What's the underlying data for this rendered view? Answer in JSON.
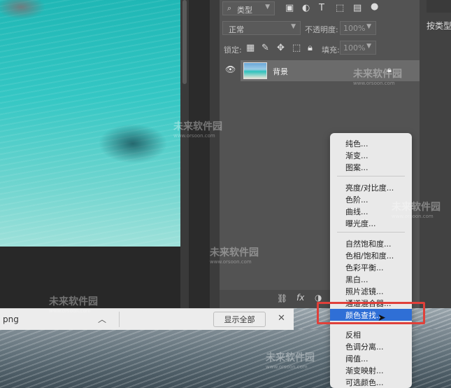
{
  "layers_panel": {
    "filter_kind": "类型",
    "blend_mode": "正常",
    "opacity_label": "不透明度:",
    "opacity_value": "100%",
    "lock_label": "锁定:",
    "fill_label": "填充:",
    "fill_value": "100%",
    "layer": {
      "name": "背景"
    },
    "footer": {
      "fx_label": "fx"
    }
  },
  "right_panel": {
    "label": "按类型"
  },
  "download_bar": {
    "file_label": "png",
    "show_all_label": "显示全部",
    "close_symbol": "✕"
  },
  "context_menu": {
    "groups": [
      [
        "纯色...",
        "渐变...",
        "图案..."
      ],
      [
        "亮度/对比度...",
        "色阶...",
        "曲线...",
        "曝光度..."
      ],
      [
        "自然饱和度...",
        "色相/饱和度...",
        "色彩平衡...",
        "黑白...",
        "照片滤镜...",
        "通道混合器...",
        "颜色查找..."
      ],
      [
        "反相",
        "色调分离...",
        "阈值...",
        "渐变映射...",
        "可选颜色..."
      ]
    ],
    "selected_item": "颜色查找..."
  },
  "watermark": {
    "name": "未来软件园",
    "url": "www.orsoon.com"
  },
  "colors": {
    "menu_selection": "#2f6fd6",
    "highlight_border": "#e0403a",
    "panel_bg": "#535353"
  },
  "icons": [
    "search-icon",
    "image-filter-icon",
    "adjustment-filter-icon",
    "type-filter-icon",
    "shape-filter-icon",
    "smart-object-filter-icon",
    "filter-toggle-icon",
    "lock-pixels-icon",
    "lock-brush-icon",
    "lock-move-icon",
    "lock-artboard-icon",
    "lock-all-icon",
    "eye-icon",
    "lock-icon",
    "link-icon",
    "fx-icon",
    "adjustment-icon",
    "chevron-up-icon",
    "close-icon",
    "cursor-icon"
  ]
}
